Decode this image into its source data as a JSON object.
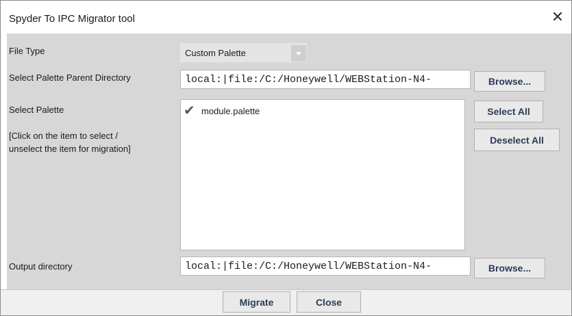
{
  "window": {
    "title": "Spyder To IPC Migrator tool",
    "close_icon": "close-icon"
  },
  "form": {
    "file_type_label": "File Type",
    "file_type_value": "Custom Palette",
    "palette_parent_label": "Select Palette Parent Directory",
    "palette_parent_value": "local:|file:/C:/Honeywell/WEBStation-N4-",
    "browse_label": "Browse...",
    "select_palette_label": "Select Palette",
    "hint_line1": "[Click on the item to select /",
    "hint_line2": "unselect the item for migration]",
    "palettes": [
      {
        "name": "module.palette",
        "selected": true
      }
    ],
    "select_all_label": "Select All",
    "deselect_all_label": "Deselect All",
    "output_dir_label": "Output directory",
    "output_dir_value": "local:|file:/C:/Honeywell/WEBStation-N4-",
    "output_browse_label": "Browse..."
  },
  "footer": {
    "migrate_label": "Migrate",
    "close_label": "Close"
  },
  "colors": {
    "content_bg": "#d7d7d7",
    "button_text": "#2b3d55"
  }
}
